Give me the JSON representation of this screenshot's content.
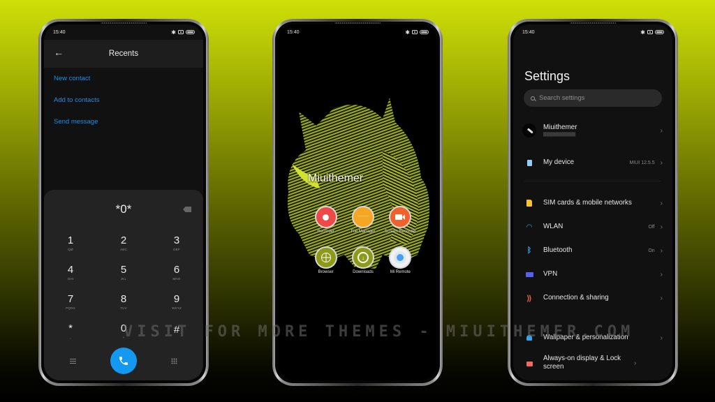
{
  "status_bar": {
    "time": "15:40"
  },
  "dialer": {
    "header_title": "Recents",
    "links": [
      "New contact",
      "Add to contacts",
      "Send message"
    ],
    "display": "*0*",
    "keys": [
      {
        "digit": "1",
        "letters": "QØ"
      },
      {
        "digit": "2",
        "letters": "ABC"
      },
      {
        "digit": "3",
        "letters": "DEF"
      },
      {
        "digit": "4",
        "letters": "GHI"
      },
      {
        "digit": "5",
        "letters": "JKL"
      },
      {
        "digit": "6",
        "letters": "MNO"
      },
      {
        "digit": "7",
        "letters": "PQRS"
      },
      {
        "digit": "8",
        "letters": "TUV"
      },
      {
        "digit": "9",
        "letters": "WXYZ"
      },
      {
        "digit": "*",
        "letters": ","
      },
      {
        "digit": "0",
        "letters": "+"
      },
      {
        "digit": "#",
        "letters": ""
      }
    ],
    "call_color": "#1499f2"
  },
  "home": {
    "folder_title": "Miuithemer",
    "apps": [
      {
        "label": "Recorder",
        "icon": "recorder-icon"
      },
      {
        "label": "File Manager",
        "icon": "folder-icon"
      },
      {
        "label": "Screen Recorder",
        "icon": "video-camera-icon"
      },
      {
        "label": "Browser",
        "icon": "globe-icon"
      },
      {
        "label": "Downloads",
        "icon": "download-icon"
      },
      {
        "label": "Mi Remote",
        "icon": "remote-icon"
      }
    ]
  },
  "settings": {
    "title": "Settings",
    "search_placeholder": "Search settings",
    "account": {
      "name": "Miuithemer"
    },
    "items": [
      {
        "label": "My device",
        "value": "MIUI 12.5.5",
        "icon": "phone-icon"
      },
      {
        "label": "SIM cards & mobile networks",
        "value": "",
        "icon": "sim-card-icon"
      },
      {
        "label": "WLAN",
        "value": "Off",
        "icon": "wifi-icon"
      },
      {
        "label": "Bluetooth",
        "value": "On",
        "icon": "bluetooth-icon"
      },
      {
        "label": "VPN",
        "value": "",
        "icon": "vpn-icon"
      },
      {
        "label": "Connection & sharing",
        "value": "",
        "icon": "connection-sharing-icon"
      },
      {
        "label": "Wallpaper & personalization",
        "value": "",
        "icon": "wallpaper-icon"
      },
      {
        "label": "Always-on display & Lock screen",
        "value": "",
        "icon": "lock-icon"
      }
    ]
  },
  "watermark": "VISIT FOR MORE THEMES - MIUITHEMER.COM"
}
